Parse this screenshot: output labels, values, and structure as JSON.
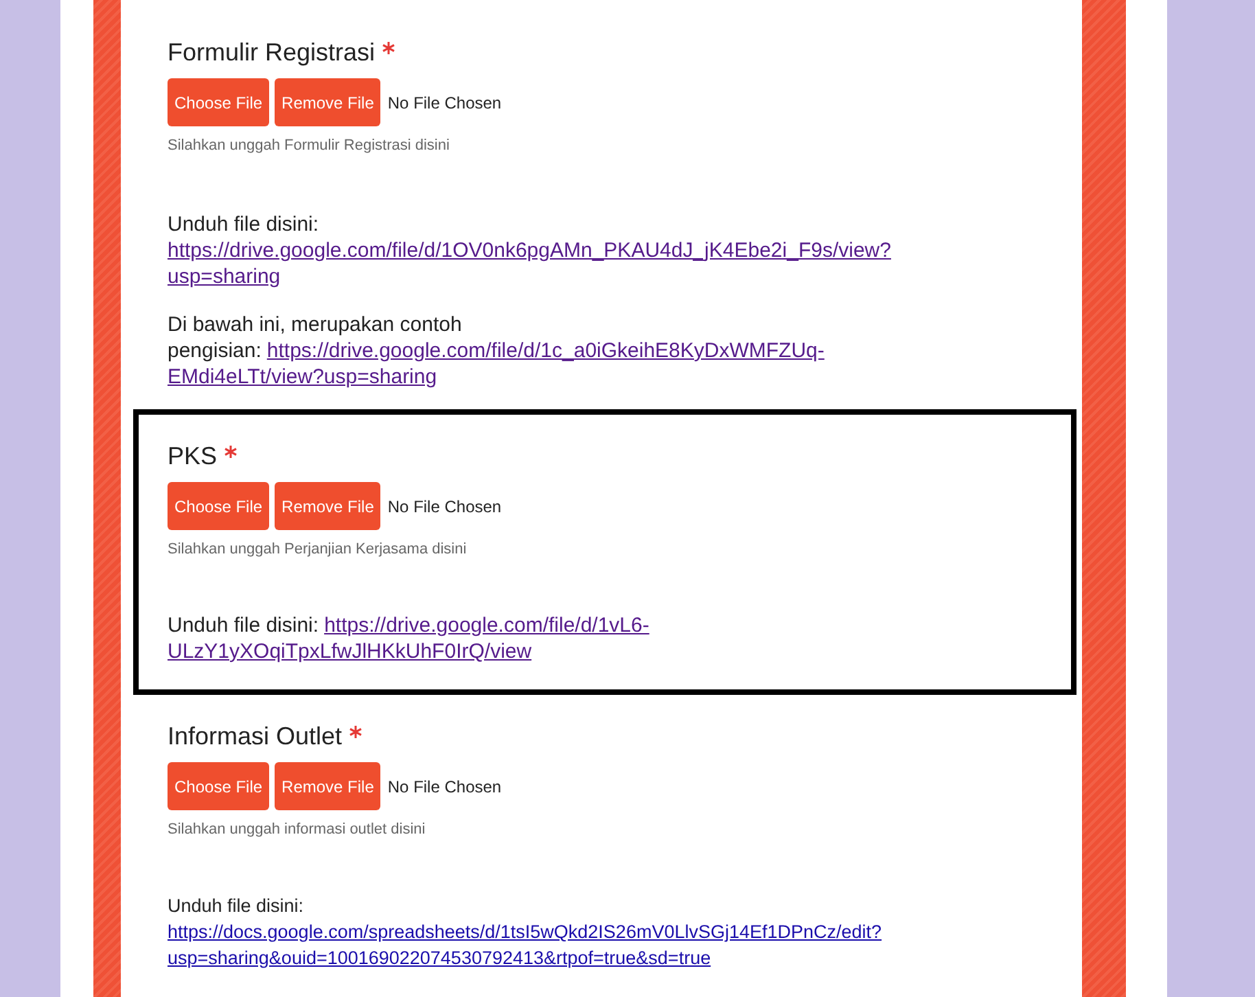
{
  "fields": [
    {
      "title": "Formulir Registrasi",
      "required": true,
      "highlighted": false,
      "choose_button": "Choose File",
      "remove_button": "Remove File",
      "status": "No File Chosen",
      "hint": "Silahkan unggah Formulir Registrasi disini",
      "paragraphs": [
        {
          "lines": [
            [
              {
                "kind": "text",
                "text": "Unduh file disini:"
              }
            ],
            [
              {
                "kind": "link",
                "text": "https://drive.google.com/file/d/1OV0nk6pgAMn_PKAU4dJ_jK4Ebe2i_F9s/view?",
                "visited": true
              }
            ],
            [
              {
                "kind": "link",
                "text": "usp=sharing",
                "visited": true
              }
            ]
          ]
        },
        {
          "lines": [
            [
              {
                "kind": "text",
                "text": "Di bawah ini, merupakan contoh"
              }
            ],
            [
              {
                "kind": "text",
                "text": "pengisian:"
              },
              {
                "kind": "link",
                "text": "https://drive.google.com/file/d/1c_a0iGkeihE8KyDxWMFZUq-",
                "visited": true
              }
            ],
            [
              {
                "kind": "link",
                "text": "EMdi4eLTt/view?usp=sharing",
                "visited": true
              }
            ]
          ]
        }
      ]
    },
    {
      "title": "PKS",
      "required": true,
      "highlighted": true,
      "choose_button": "Choose File",
      "remove_button": "Remove File",
      "status": "No File Chosen",
      "hint": "Silahkan unggah Perjanjian Kerjasama disini",
      "paragraphs": [
        {
          "lines": [
            [
              {
                "kind": "text",
                "text": "Unduh file disini:"
              },
              {
                "kind": "link",
                "text": "https://drive.google.com/file/d/1vL6-",
                "visited": true
              }
            ],
            [
              {
                "kind": "link",
                "text": "ULzY1yXOqiTpxLfwJlHKkUhF0IrQ/view",
                "visited": true
              }
            ]
          ]
        }
      ]
    },
    {
      "title": "Informasi Outlet",
      "required": true,
      "highlighted": false,
      "choose_button": "Choose File",
      "remove_button": "Remove File",
      "status": "No File Chosen",
      "hint": "Silahkan unggah informasi outlet disini",
      "paragraphs": [
        {
          "lines": [
            [
              {
                "kind": "text",
                "text": "Unduh file disini:"
              }
            ],
            [
              {
                "kind": "link",
                "text": "https://docs.google.com/spreadsheets/d/1tsI5wQkd2IS26mV0LlvSGj14Ef1DPnCz/edit?",
                "visited": false
              }
            ],
            [
              {
                "kind": "link",
                "text": "usp=sharing&ouid=100169022074530792413&rtpof=true&sd=true",
                "visited": false
              }
            ]
          ]
        }
      ]
    }
  ]
}
